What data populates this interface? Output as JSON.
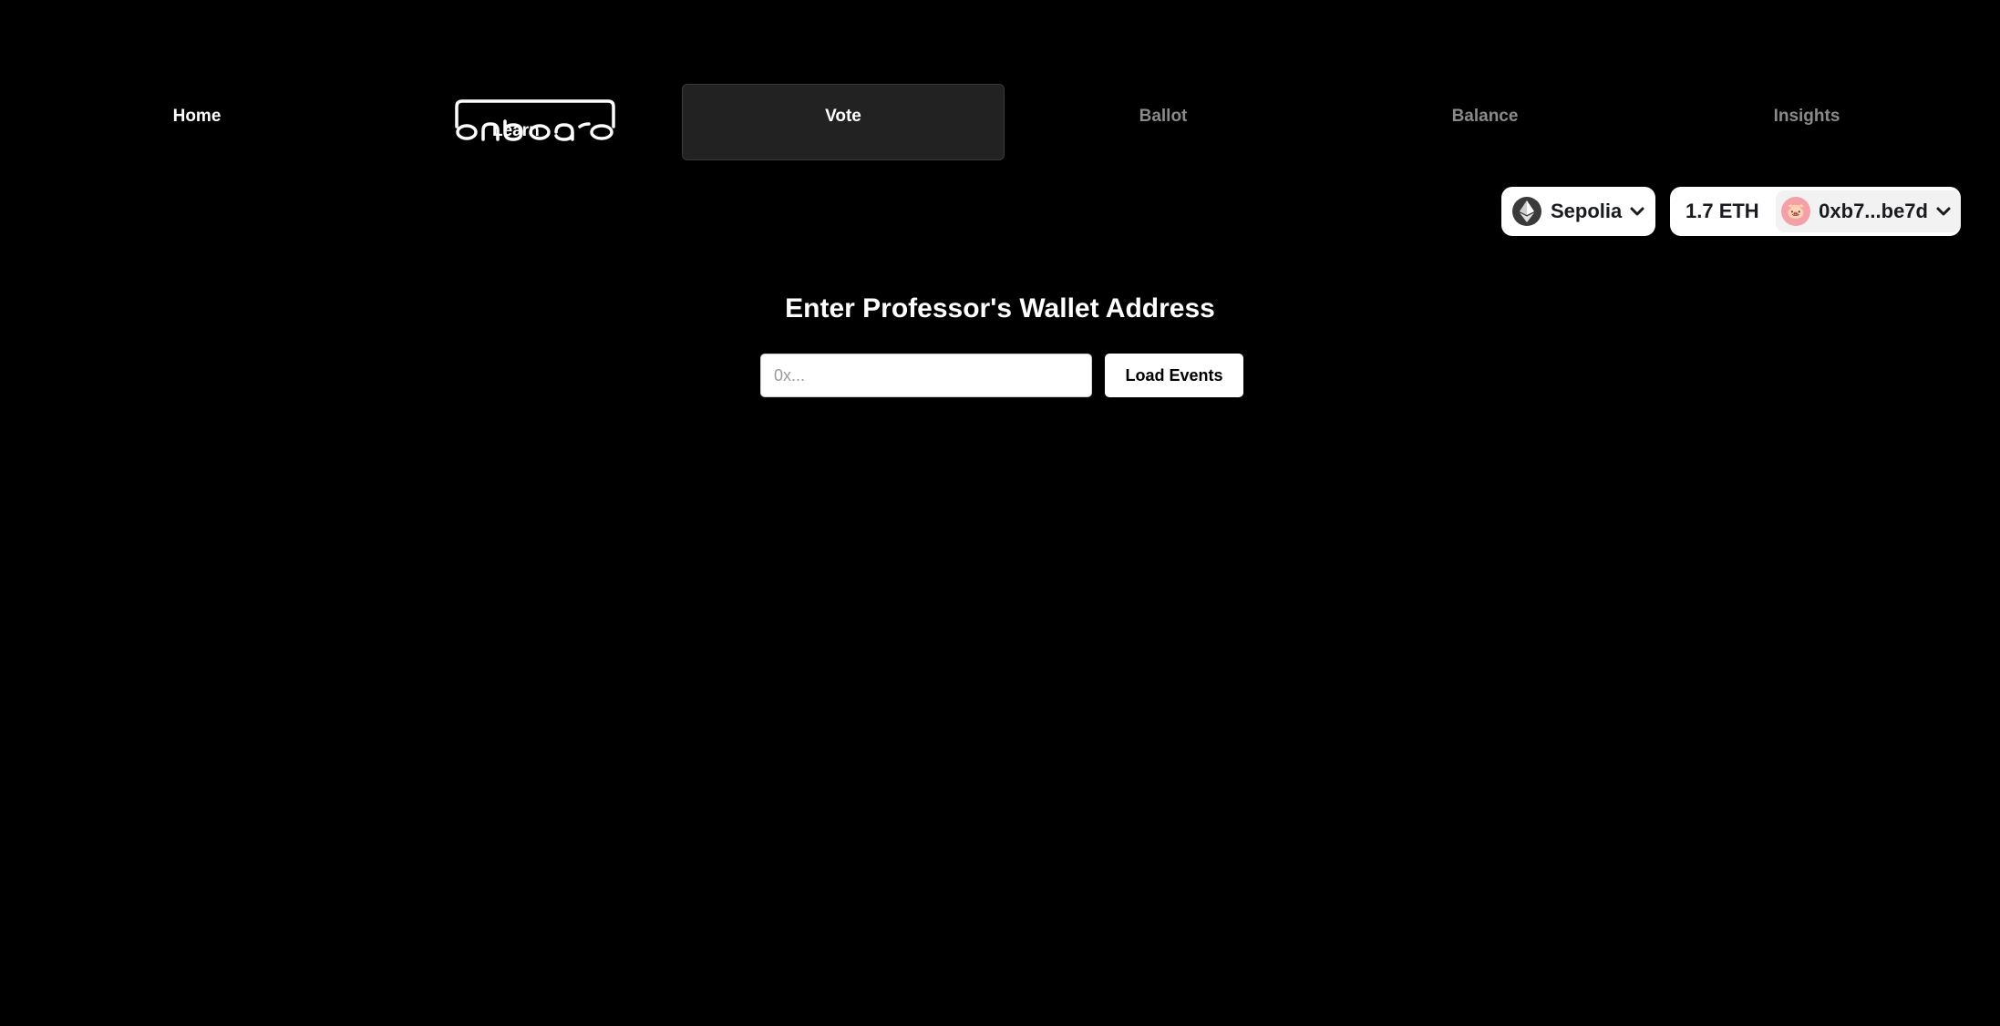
{
  "nav": {
    "items": [
      {
        "label": "Home"
      },
      {
        "label": "Learn"
      },
      {
        "label": "Vote"
      },
      {
        "label": "Ballot"
      },
      {
        "label": "Balance"
      },
      {
        "label": "Insights"
      }
    ],
    "active": "Vote"
  },
  "wallet": {
    "chain_label": "Sepolia",
    "chain_icon": "ethereum-icon",
    "balance": "1.7 ETH",
    "address": "0xb7...be7d",
    "avatar_icon": "pig-emoji-avatar"
  },
  "main": {
    "heading": "Enter Professor's Wallet Address",
    "input_placeholder": "0x...",
    "input_value": "",
    "load_button_label": "Load Events"
  },
  "colors": {
    "background": "#000000",
    "active_tab": "#222222",
    "muted_text": "#8a8a8a",
    "text": "#ffffff"
  }
}
